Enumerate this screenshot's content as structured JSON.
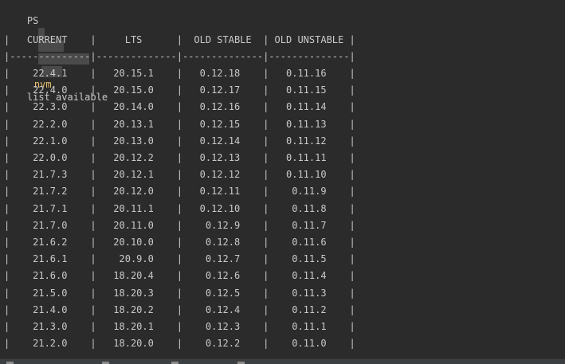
{
  "terminal": {
    "prompt_prefix": "PS",
    "command_name": "nvm",
    "command_args": "list available",
    "table": {
      "header_line": "|   CURRENT    |     LTS      |  OLD STABLE  | OLD UNSTABLE |",
      "separator_line": "|--------------|--------------|--------------|--------------|",
      "rows": [
        "|    22.4.1    |   20.15.1    |   0.12.18    |   0.11.16    |",
        "|    22.4.0    |   20.15.0    |   0.12.17    |   0.11.15    |",
        "|    22.3.0    |   20.14.0    |   0.12.16    |   0.11.14    |",
        "|    22.2.0    |   20.13.1    |   0.12.15    |   0.11.13    |",
        "|    22.1.0    |   20.13.0    |   0.12.14    |   0.11.12    |",
        "|    22.0.0    |   20.12.2    |   0.12.13    |   0.11.11    |",
        "|    21.7.3    |   20.12.1    |   0.12.12    |   0.11.10    |",
        "|    21.7.2    |   20.12.0    |   0.12.11    |    0.11.9    |",
        "|    21.7.1    |   20.11.1    |   0.12.10    |    0.11.8    |",
        "|    21.7.0    |   20.11.0    |    0.12.9    |    0.11.7    |",
        "|    21.6.2    |   20.10.0    |    0.12.8    |    0.11.6    |",
        "|    21.6.1    |    20.9.0    |    0.12.7    |    0.11.5    |",
        "|    21.6.0    |   18.20.4    |    0.12.6    |    0.11.4    |",
        "|    21.5.0    |   18.20.3    |    0.12.5    |    0.11.3    |",
        "|    21.4.0    |   18.20.2    |    0.12.4    |    0.11.2    |",
        "|    21.3.0    |   18.20.1    |    0.12.3    |    0.11.1    |",
        "|    21.2.0    |   18.20.0    |    0.12.2    |    0.11.0    |"
      ]
    }
  },
  "colors": {
    "background": "#2b2b2b",
    "text": "#c9c9c9",
    "command": "#e8bf6a",
    "bottom_bar": "#3c3f41"
  },
  "bottom_bar": {
    "tab_icons": [
      "git-icon",
      "problems-icon",
      "terminal-icon",
      "services-icon"
    ]
  }
}
